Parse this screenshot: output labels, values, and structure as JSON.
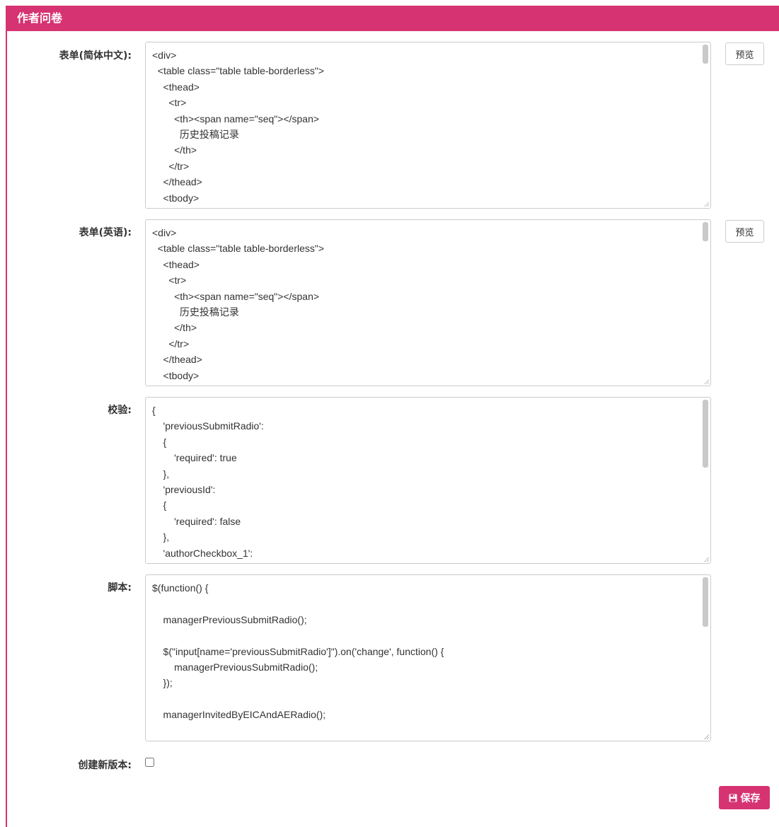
{
  "panel": {
    "title": "作者问卷"
  },
  "fields": {
    "form_zh": {
      "label": "表单(简体中文):",
      "code": "<div>\n  <table class=\"table table-borderless\">\n    <thead>\n      <tr>\n        <th><span name=\"seq\"></span>\n          历史投稿记录\n        </th>\n      </tr>\n    </thead>\n    <tbody>",
      "preview_label": "预览"
    },
    "form_en": {
      "label": "表单(英语):",
      "code": "<div>\n  <table class=\"table table-borderless\">\n    <thead>\n      <tr>\n        <th><span name=\"seq\"></span>\n          历史投稿记录\n        </th>\n      </tr>\n    </thead>\n    <tbody>",
      "preview_label": "预览"
    },
    "validation": {
      "label": "校验:",
      "code": "{\n    'previousSubmitRadio':\n    {\n        'required': true\n    },\n    'previousId':\n    {\n        'required': false\n    },\n    'authorCheckbox_1':"
    },
    "script": {
      "label": "脚本:",
      "code": "$(function() {\n\n    managerPreviousSubmitRadio();\n\n    $(\"input[name='previousSubmitRadio']\").on('change', function() {\n        managerPreviousSubmitRadio();\n    });\n\n    managerInvitedByEICAndAERadio();"
    },
    "new_version": {
      "label": "创建新版本:",
      "checked": false
    }
  },
  "actions": {
    "save_label": "保存",
    "save_icon": "floppy-disk-icon"
  },
  "colors": {
    "accent": "#d63372"
  }
}
